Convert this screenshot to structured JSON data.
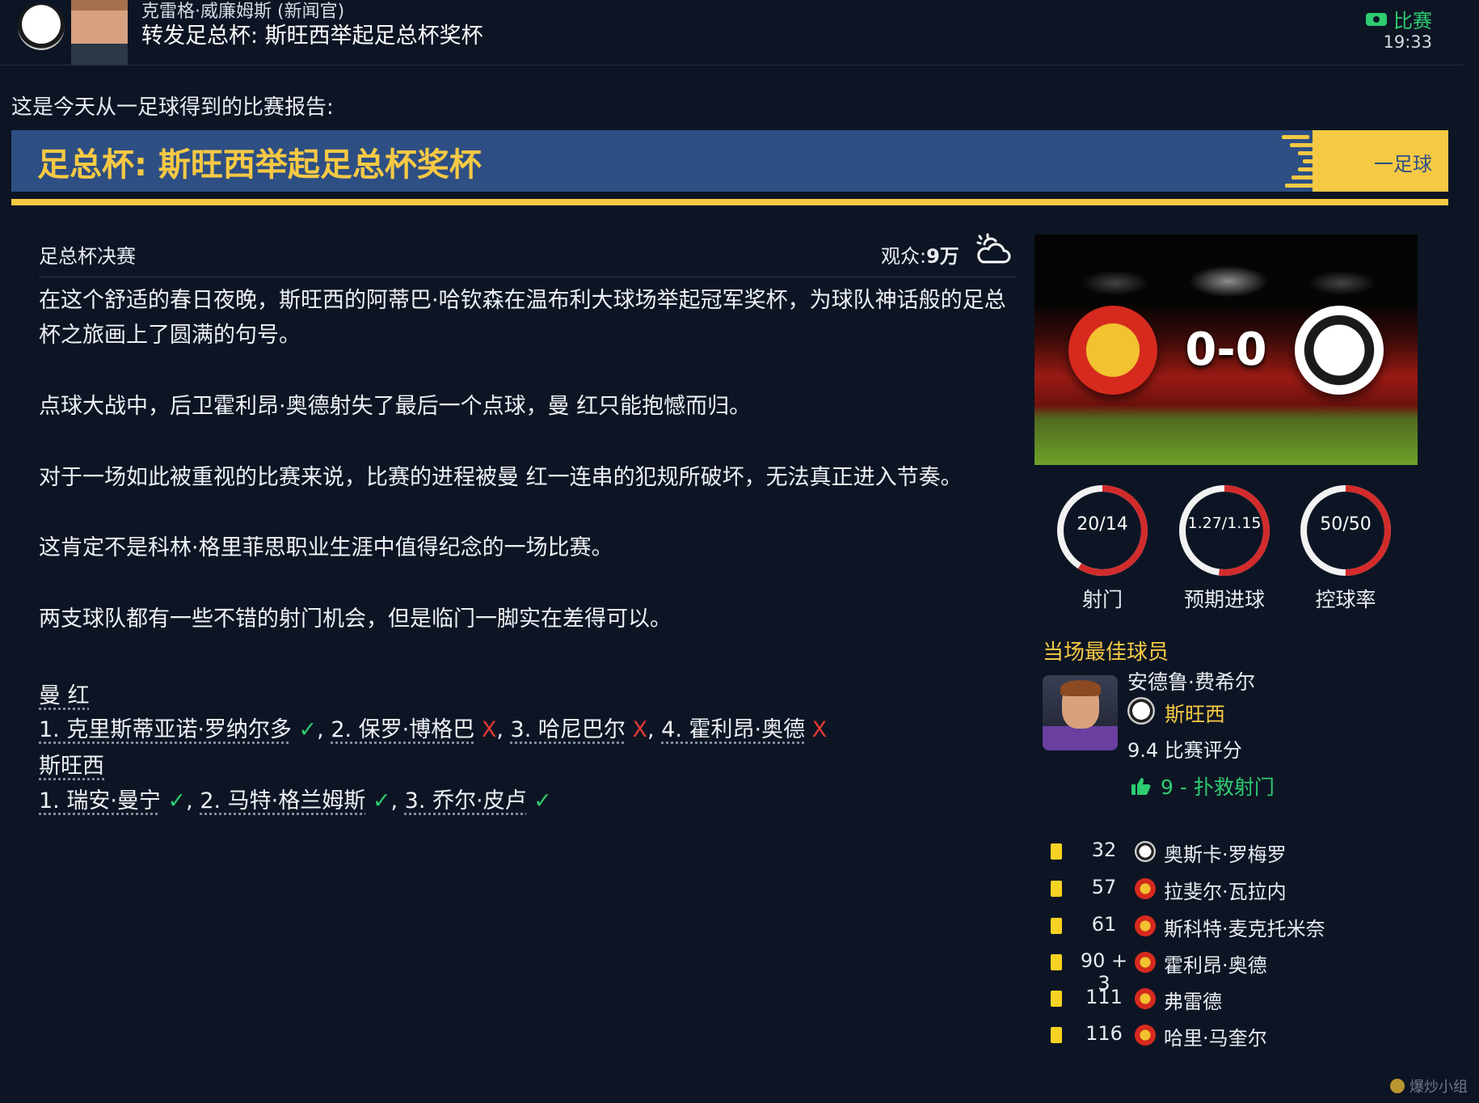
{
  "header": {
    "sender": "克雷格·威廉姆斯 (新闻官)",
    "title": "转发足总杯: 斯旺西举起足总杯奖杯",
    "category": "比赛",
    "time": "19:33"
  },
  "intro": "这是今天从一足球得到的比赛报告:",
  "banner": {
    "title": "足总杯: 斯旺西举起足总杯奖杯",
    "source": "一足球"
  },
  "colors": {
    "accent": "#f6c944",
    "banner_bg": "#2e4f84",
    "positive": "#2ecc71",
    "negative": "#e53935",
    "background": "#0d1524"
  },
  "article": {
    "competition": "足总杯决赛",
    "attendance_label": "观众:",
    "attendance_value": "9万",
    "weather_icon": "partly-cloudy-icon",
    "paragraphs": [
      "在这个舒适的春日夜晚，斯旺西的阿蒂巴·哈钦森在温布利大球场举起冠军奖杯，为球队神话般的足总杯之旅画上了圆满的句号。",
      "点球大战中，后卫霍利昂·奥德射失了最后一个点球，曼 红只能抱憾而归。",
      "对于一场如此被重视的比赛来说，比赛的进程被曼 红一连串的犯规所破坏，无法真正进入节奏。",
      "这肯定不是科林·格里菲思职业生涯中值得纪念的一场比赛。",
      "两支球队都有一些不错的射门机会，但是临门一脚实在差得可以。"
    ],
    "shootout": [
      {
        "team": "曼 红",
        "kicks": [
          {
            "text": "1. 克里斯蒂亚诺·罗纳尔多",
            "mark": "✓",
            "scored": true
          },
          {
            "text": "2. 保罗·博格巴",
            "mark": "X",
            "scored": false
          },
          {
            "text": "3. 哈尼巴尔",
            "mark": "X",
            "scored": false
          },
          {
            "text": "4. 霍利昂·奥德",
            "mark": "X",
            "scored": false
          }
        ]
      },
      {
        "team": "斯旺西",
        "kicks": [
          {
            "text": "1. 瑞安·曼宁",
            "mark": "✓",
            "scored": true
          },
          {
            "text": "2. 马特·格兰姆斯",
            "mark": "✓",
            "scored": true
          },
          {
            "text": "3. 乔尔·皮卢",
            "mark": "✓",
            "scored": true
          }
        ]
      }
    ]
  },
  "match": {
    "home_score": "0",
    "separator": "-",
    "away_score": "0",
    "home_crest": "manchester-united-crest",
    "away_crest": "swansea-city-crest",
    "stats": [
      {
        "label": "射门",
        "value": "20/14",
        "home_share": 0.59
      },
      {
        "label": "预期进球",
        "value": "1.27/1.15",
        "home_share": 0.52
      },
      {
        "label": "控球率",
        "value": "50/50",
        "home_share": 0.5
      }
    ]
  },
  "potm": {
    "title": "当场最佳球员",
    "name": "安德鲁·费希尔",
    "club": "斯旺西",
    "rating": "9.4 比赛评分",
    "highlight": "9 - 扑救射门",
    "highlight_icon": "thumbs-up-icon"
  },
  "bookings": [
    {
      "minute": "32",
      "team": "swansea",
      "player": "奥斯卡·罗梅罗"
    },
    {
      "minute": "57",
      "team": "man-utd",
      "player": "拉斐尔·瓦拉内"
    },
    {
      "minute": "61",
      "team": "man-utd",
      "player": "斯科特·麦克托米奈"
    },
    {
      "minute": "90 + 3",
      "team": "man-utd",
      "player": "霍利昂·奥德"
    },
    {
      "minute": "111",
      "team": "man-utd",
      "player": "弗雷德"
    },
    {
      "minute": "116",
      "team": "man-utd",
      "player": "哈里·马奎尔"
    }
  ],
  "watermark": "爆炒小组"
}
